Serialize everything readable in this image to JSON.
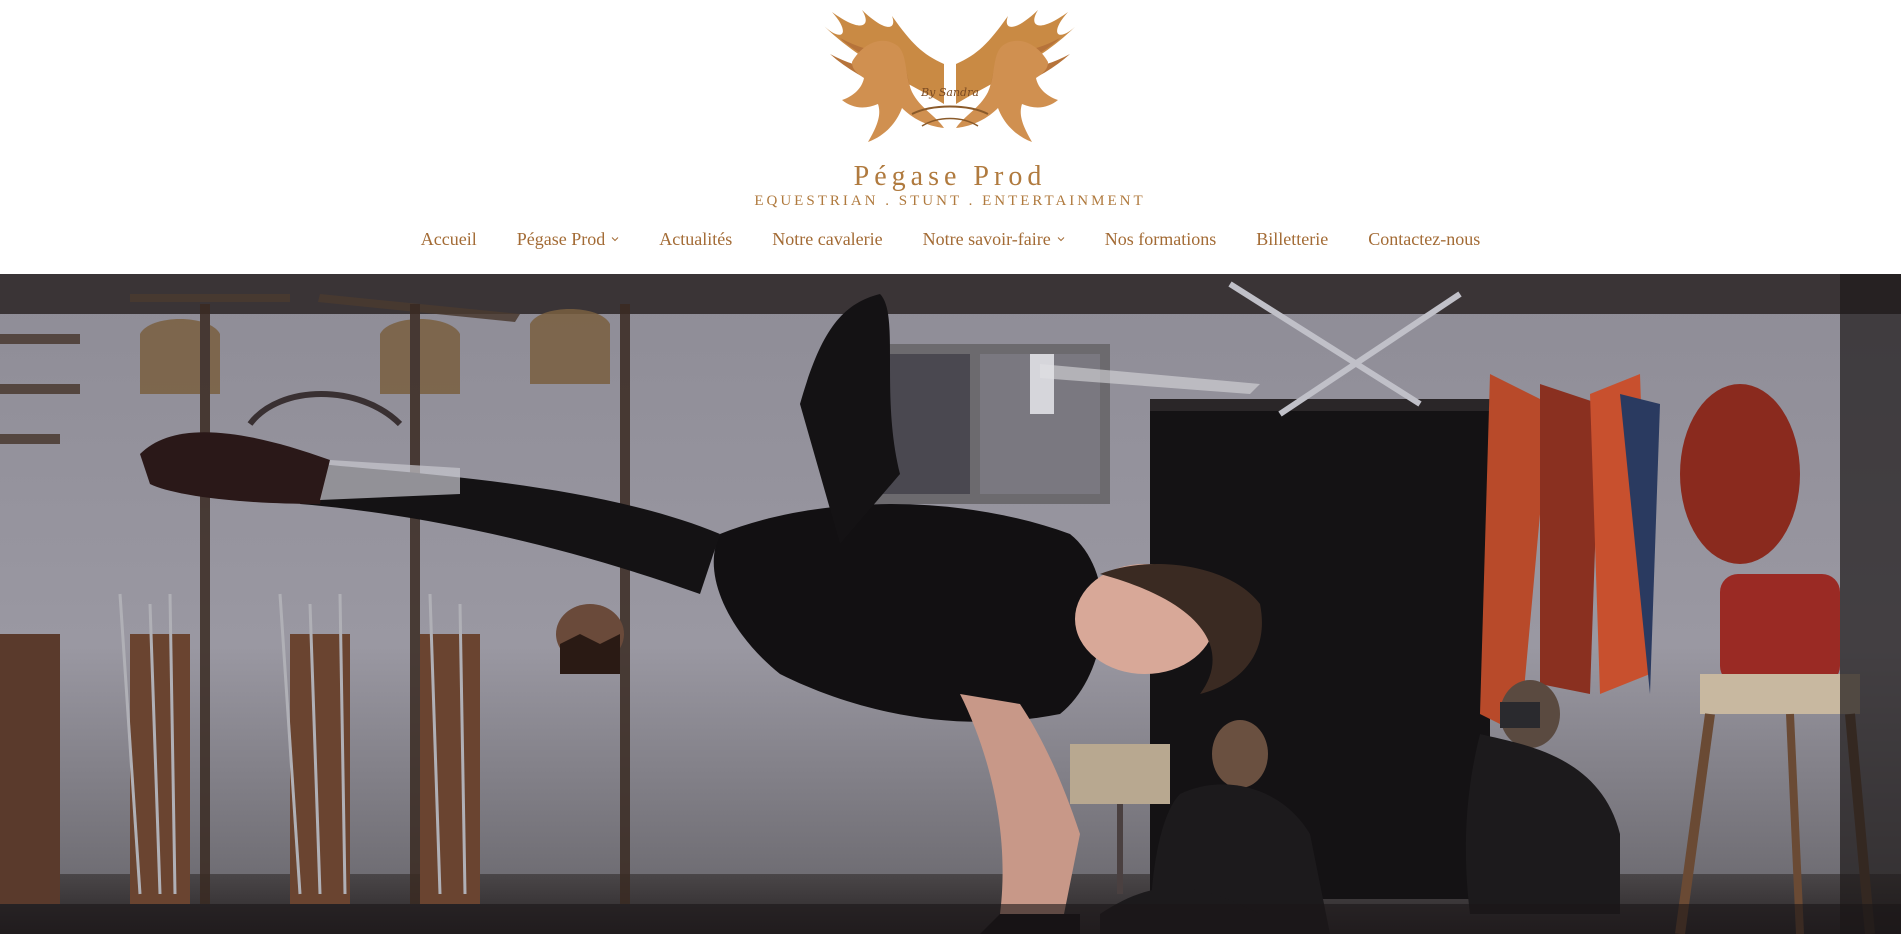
{
  "brand": {
    "title": "Pégase Prod",
    "tagline": "EQUESTRIAN . STUNT . ENTERTAINMENT",
    "signature": "By Sandra",
    "logo_icon": "winged-horses-emblem",
    "color": "#b07a3e"
  },
  "nav": {
    "items": [
      {
        "label": "Accueil",
        "has_dropdown": false
      },
      {
        "label": "Pégase Prod",
        "has_dropdown": true
      },
      {
        "label": "Actualités",
        "has_dropdown": false
      },
      {
        "label": "Notre cavalerie",
        "has_dropdown": false
      },
      {
        "label": "Notre savoir-faire",
        "has_dropdown": true
      },
      {
        "label": "Nos formations",
        "has_dropdown": false
      },
      {
        "label": "Billetterie",
        "has_dropdown": false
      },
      {
        "label": "Contactez-nous",
        "has_dropdown": false
      }
    ],
    "color": "#a36b35"
  },
  "hero": {
    "media_type": "video"
  }
}
